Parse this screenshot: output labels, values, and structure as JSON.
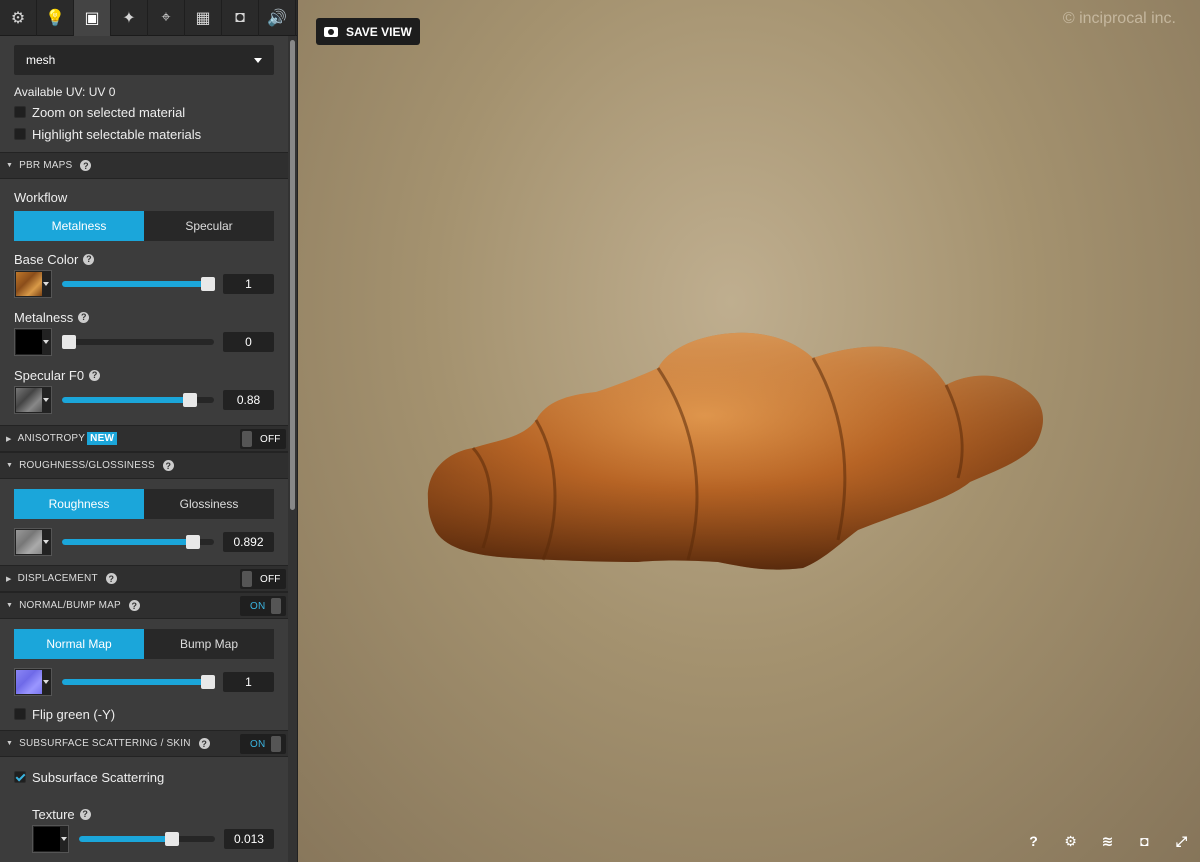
{
  "tabs": [
    {
      "icon": "gear-icon",
      "glyph": "⚙",
      "active": false
    },
    {
      "icon": "lightbulb-icon",
      "glyph": "💡",
      "active": false
    },
    {
      "icon": "image-icon",
      "glyph": "▣",
      "active": true
    },
    {
      "icon": "magic-wand-icon",
      "glyph": "✦",
      "active": false
    },
    {
      "icon": "location-pin-icon",
      "glyph": "⌖",
      "active": false
    },
    {
      "icon": "film-icon",
      "glyph": "▦",
      "active": false
    },
    {
      "icon": "vr-headset-icon",
      "glyph": "◘",
      "active": false
    },
    {
      "icon": "speaker-icon",
      "glyph": "🔊",
      "active": false
    }
  ],
  "material": {
    "selected": "mesh",
    "uv_note": "Available UV: UV 0",
    "zoom_label": "Zoom on selected material",
    "highlight_label": "Highlight selectable materials"
  },
  "pbr": {
    "header": "PBR MAPS",
    "workflow_label": "Workflow",
    "metalness_tab": "Metalness",
    "specular_tab": "Specular",
    "base_color": {
      "label": "Base Color",
      "value": "1",
      "fraction": 0.96
    },
    "metalness": {
      "label": "Metalness",
      "value": "0",
      "fraction": 0.0
    },
    "specular": {
      "label": "Specular F0",
      "value": "0.88",
      "fraction": 0.84
    }
  },
  "anisotropy": {
    "header": "ANISOTROPY",
    "badge": "NEW",
    "toggle": "OFF"
  },
  "roughness": {
    "header": "ROUGHNESS/GLOSSINESS",
    "roughness_tab": "Roughness",
    "glossiness_tab": "Glossiness",
    "value": "0.892",
    "fraction": 0.86
  },
  "displacement": {
    "header": "DISPLACEMENT",
    "toggle": "OFF"
  },
  "normal": {
    "header": "NORMAL/BUMP MAP",
    "toggle": "ON",
    "normal_tab": "Normal Map",
    "bump_tab": "Bump Map",
    "value": "1",
    "fraction": 0.96,
    "flip_label": "Flip green (-Y)"
  },
  "sss": {
    "header": "SUBSURFACE SCATTERING / SKIN",
    "toggle": "ON",
    "check_label": "Subsurface Scatterring",
    "texture_label": "Texture",
    "value": "0.013",
    "fraction": 0.68
  },
  "viewport": {
    "save_view": "SAVE VIEW",
    "watermark": "© inciprocal inc."
  },
  "bottom_icons": [
    {
      "icon": "help-icon",
      "glyph": "?"
    },
    {
      "icon": "settings-icon",
      "glyph": "⚙"
    },
    {
      "icon": "layers-icon",
      "glyph": "≋"
    },
    {
      "icon": "vr-icon",
      "glyph": "◘"
    },
    {
      "icon": "fullscreen-icon",
      "glyph": "⤢"
    }
  ]
}
